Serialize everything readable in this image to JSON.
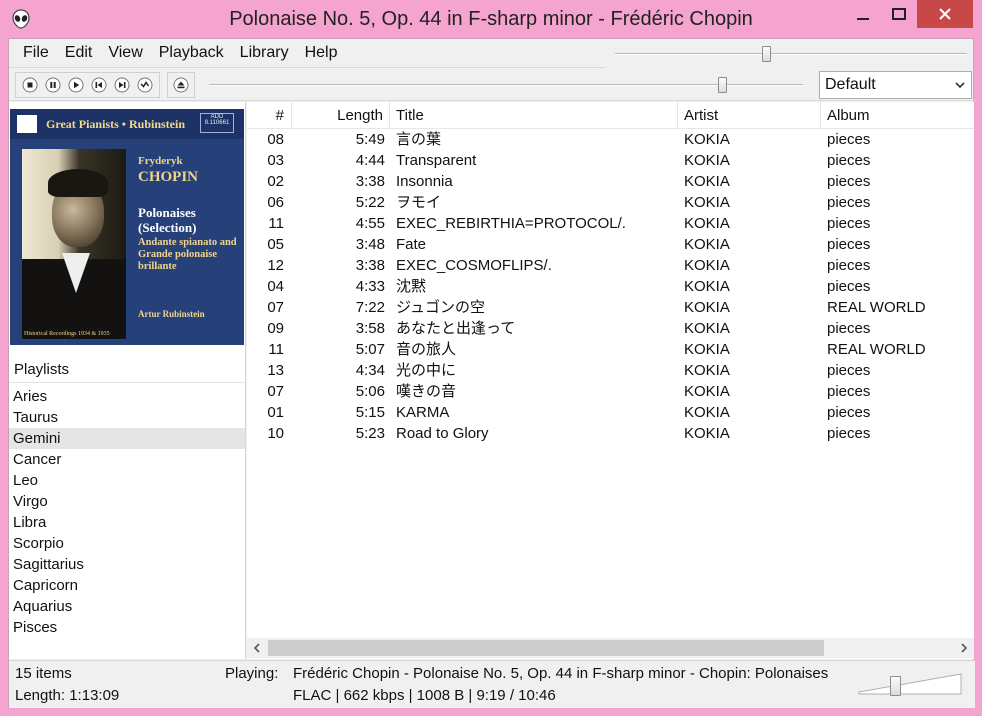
{
  "window": {
    "title": "Polonaise No. 5, Op. 44 in F-sharp minor - Frédéric Chopin"
  },
  "menu": [
    "File",
    "Edit",
    "View",
    "Playback",
    "Library",
    "Help"
  ],
  "toolbar": {
    "buttons": [
      "stop-icon",
      "pause-icon",
      "play-icon",
      "previous-icon",
      "next-icon",
      "random-icon"
    ],
    "eject": "eject-icon",
    "dsp_preset": "Default",
    "volume_level": 0.43,
    "seek_position": 0.87
  },
  "album_art": {
    "band_text": "Great Pianists • Rubinstein",
    "code": "ADD 8.110661",
    "composer_first": "Fryderyk",
    "composer_last": "CHOPIN",
    "work_title": "Polonaises (Selection)",
    "work_sub": "Andante spianato and Grande polonaise brillante",
    "performer": "Artur Rubinstein",
    "footer": "Historical Recordings 1934 & 1935"
  },
  "playlists": {
    "header": "Playlists",
    "selected_index": 2,
    "items": [
      "Aries",
      "Taurus",
      "Gemini",
      "Cancer",
      "Leo",
      "Virgo",
      "Libra",
      "Scorpio",
      "Sagittarius",
      "Capricorn",
      "Aquarius",
      "Pisces"
    ]
  },
  "tracklist": {
    "columns": {
      "num": "#",
      "length": "Length",
      "title": "Title",
      "artist": "Artist",
      "album": "Album"
    },
    "rows": [
      {
        "num": "08",
        "length": "5:49",
        "title": "言の葉",
        "artist": "KOKIA",
        "album": "pieces"
      },
      {
        "num": "03",
        "length": "4:44",
        "title": "Transparent",
        "artist": "KOKIA",
        "album": "pieces"
      },
      {
        "num": "02",
        "length": "3:38",
        "title": "Insonnia",
        "artist": "KOKIA",
        "album": "pieces"
      },
      {
        "num": "06",
        "length": "5:22",
        "title": "ヲモイ",
        "artist": "KOKIA",
        "album": "pieces"
      },
      {
        "num": "11",
        "length": "4:55",
        "title": "EXEC_REBIRTHIA=PROTOCOL/.",
        "artist": "KOKIA",
        "album": "pieces"
      },
      {
        "num": "05",
        "length": "3:48",
        "title": "Fate",
        "artist": "KOKIA",
        "album": "pieces"
      },
      {
        "num": "12",
        "length": "3:38",
        "title": "EXEC_COSMOFLIPS/.",
        "artist": "KOKIA",
        "album": "pieces"
      },
      {
        "num": "04",
        "length": "4:33",
        "title": "沈黙",
        "artist": "KOKIA",
        "album": "pieces"
      },
      {
        "num": "07",
        "length": "7:22",
        "title": "ジュゴンの空",
        "artist": "KOKIA",
        "album": "REAL WORLD"
      },
      {
        "num": "09",
        "length": "3:58",
        "title": "あなたと出逢って",
        "artist": "KOKIA",
        "album": "pieces"
      },
      {
        "num": "11",
        "length": "5:07",
        "title": "音の旅人",
        "artist": "KOKIA",
        "album": "REAL WORLD"
      },
      {
        "num": "13",
        "length": "4:34",
        "title": "光の中に",
        "artist": "KOKIA",
        "album": "pieces"
      },
      {
        "num": "07",
        "length": "5:06",
        "title": "嘆きの音",
        "artist": "KOKIA",
        "album": "pieces"
      },
      {
        "num": "01",
        "length": "5:15",
        "title": "KARMA",
        "artist": "KOKIA",
        "album": "pieces"
      },
      {
        "num": "10",
        "length": "5:23",
        "title": "Road to Glory",
        "artist": "KOKIA",
        "album": "pieces"
      }
    ]
  },
  "status": {
    "items": "15 items",
    "length": "Length: 1:13:09",
    "playing_label": "Playing:",
    "playing": "Frédéric Chopin - Polonaise No. 5, Op. 44 in F-sharp minor - Chopin: Polonaises",
    "format": "FLAC | 662 kbps | 1008 B | 9:19 / 10:46",
    "volume_level": 0.35
  }
}
